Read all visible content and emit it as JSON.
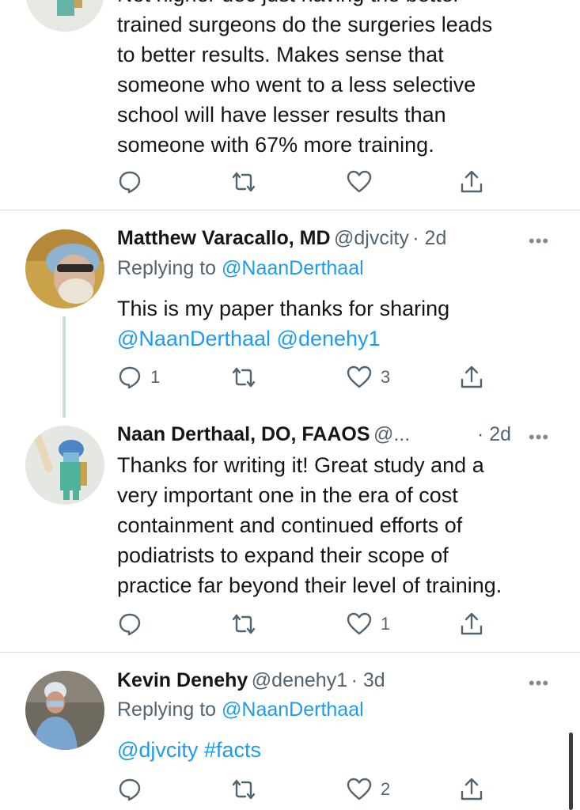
{
  "tweet0": {
    "partial_line": "Not higher dec just having the better",
    "lines": [
      "trained surgeons do the surgeries leads",
      "to better results. Makes sense that",
      "someone who went to a less selective",
      "school will have lesser results than",
      "someone with 67% more training."
    ],
    "reply_count": "",
    "like_count": ""
  },
  "tweet1": {
    "name": "Matthew Varacallo, MD",
    "handle": "@djvcity",
    "time": "· 2d",
    "replying_prefix": "Replying to",
    "replying_handle": "@NaanDerthaal",
    "text_line1": "This is my paper thanks for sharing",
    "mention1": "@NaanDerthaal",
    "mention2": "@denehy1",
    "reply_count": "1",
    "like_count": "3"
  },
  "tweet2": {
    "name": "Naan Derthaal, DO, FAAOS",
    "handle": "@...",
    "time": "· 2d",
    "lines": [
      "Thanks for writing it! Great study and a",
      "very important one in the era of cost",
      "containment and continued efforts of",
      "podiatrists to expand their scope of",
      "practice far beyond their level of training."
    ],
    "reply_count": "",
    "like_count": "1"
  },
  "tweet3": {
    "name": "Kevin Denehy",
    "handle": "@denehy1",
    "time": "· 3d",
    "replying_prefix": "Replying to",
    "replying_handle": "@NaanDerthaal",
    "mention": "@djvcity",
    "hashtag": "#facts",
    "reply_count": "",
    "like_count": "2"
  },
  "icons": {
    "more": "more-horizontal-icon",
    "reply": "reply-bubble-icon",
    "retweet": "retweet-icon",
    "like": "heart-icon",
    "share": "share-icon"
  },
  "colors": {
    "link": "#1d9bf0",
    "text": "#14171a",
    "secondary": "#536471",
    "divider": "#d9dde1"
  }
}
